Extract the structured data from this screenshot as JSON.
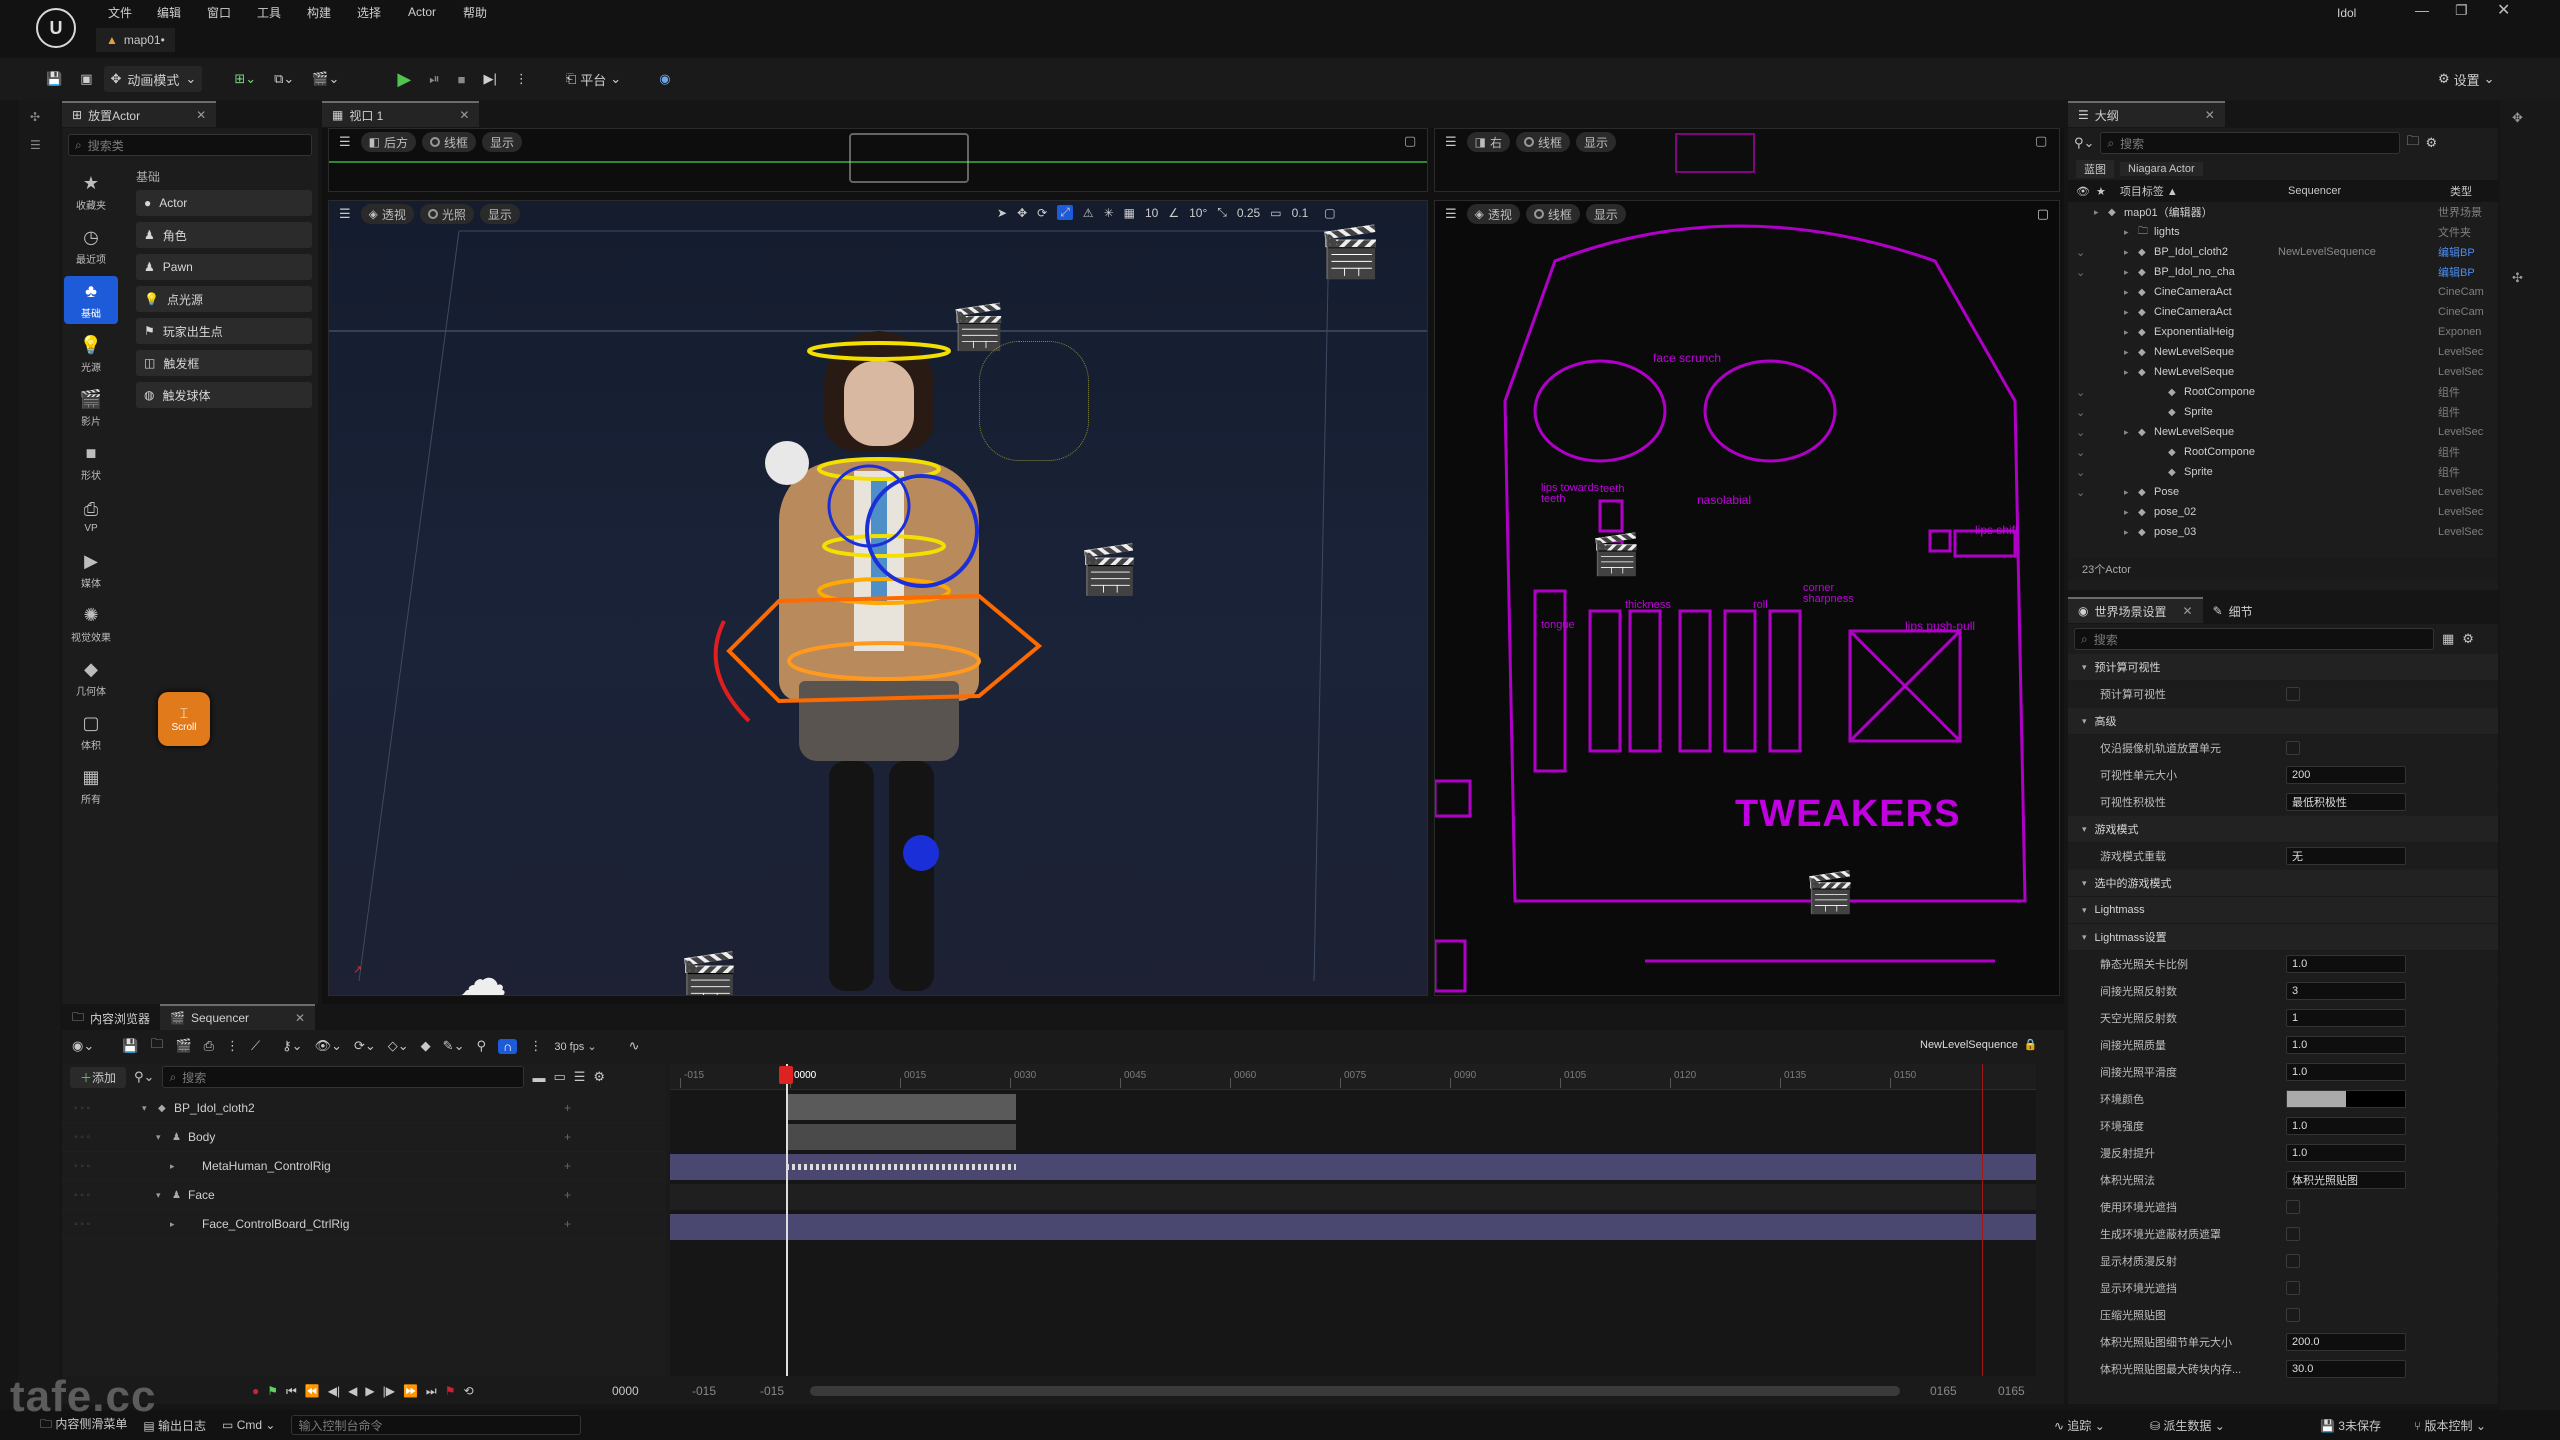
{
  "menu": {
    "items": [
      "文件",
      "编辑",
      "窗口",
      "工具",
      "构建",
      "选择",
      "Actor",
      "帮助"
    ],
    "project": "Idol"
  },
  "map_tab": "map01•",
  "toolbar": {
    "mode": "动画模式",
    "platform": "平台",
    "settings": "设置"
  },
  "place_actor": {
    "tab": "放置Actor",
    "search_placeholder": "搜索类",
    "category": "基础",
    "nav": [
      "收藏夹",
      "最近项",
      "基础",
      "光源",
      "影片",
      "形状",
      "VP",
      "媒体",
      "视觉效果",
      "几何体",
      "体积",
      "所有"
    ],
    "items": [
      "Actor",
      "角色",
      "Pawn",
      "点光源",
      "玩家出生点",
      "触发框",
      "触发球体"
    ]
  },
  "scroll_badge": "Scroll",
  "viewport": {
    "tab": "视口 1",
    "top_left": {
      "view": "后方",
      "mode": "线框",
      "show": "显示"
    },
    "main": {
      "view": "透视",
      "mode": "光照",
      "show": "显示",
      "grid": "10",
      "angle": "10°",
      "scale": "0.25",
      "cam": "0.1"
    },
    "top_right": {
      "view": "右",
      "mode": "线框",
      "show": "显示"
    },
    "right": {
      "view": "透视",
      "mode": "线框",
      "show": "显示"
    },
    "rig_labels": [
      "face scrunch",
      "lips towards teeth",
      "teeth",
      "nasolabial",
      "lips shift",
      "tongue",
      "thickness",
      "roll",
      "corner sharpness",
      "lips push-pull"
    ],
    "tweakers": "TWEAKERS"
  },
  "outliner": {
    "tab": "大纲",
    "search_placeholder": "搜索",
    "filters": [
      "蓝图",
      "Niagara Actor"
    ],
    "columns": {
      "label": "项目标签 ▲",
      "seq": "Sequencer",
      "type": "类型"
    },
    "rows": [
      {
        "label": "map01（编辑器）",
        "seq": "",
        "type": "世界场景"
      },
      {
        "label": "lights",
        "seq": "",
        "type": "文件夹"
      },
      {
        "label": "BP_Idol_cloth2",
        "seq": "NewLevelSequence",
        "type": "编辑BP"
      },
      {
        "label": "BP_Idol_no_cha",
        "seq": "",
        "type": "编辑BP"
      },
      {
        "label": "CineCameraAct",
        "seq": "",
        "type": "CineCam"
      },
      {
        "label": "CineCameraAct",
        "seq": "",
        "type": "CineCam"
      },
      {
        "label": "ExponentialHeig",
        "seq": "",
        "type": "Exponen"
      },
      {
        "label": "NewLevelSeque",
        "seq": "",
        "type": "LevelSec"
      },
      {
        "label": "NewLevelSeque",
        "seq": "",
        "type": "LevelSec"
      },
      {
        "label": "RootCompone",
        "seq": "",
        "type": "组件"
      },
      {
        "label": "Sprite",
        "seq": "",
        "type": "组件"
      },
      {
        "label": "NewLevelSeque",
        "seq": "",
        "type": "LevelSec"
      },
      {
        "label": "RootCompone",
        "seq": "",
        "type": "组件"
      },
      {
        "label": "Sprite",
        "seq": "",
        "type": "组件"
      },
      {
        "label": "Pose",
        "seq": "",
        "type": "LevelSec"
      },
      {
        "label": "pose_02",
        "seq": "",
        "type": "LevelSec"
      },
      {
        "label": "pose_03",
        "seq": "",
        "type": "LevelSec"
      }
    ],
    "count": "23个Actor"
  },
  "details": {
    "tab": "世界场景设置",
    "tab2": "细节",
    "search_placeholder": "搜索",
    "rows": [
      {
        "kind": "sec",
        "label": "预计算可视性"
      },
      {
        "kind": "chk",
        "label": "预计算可视性"
      },
      {
        "kind": "sec",
        "label": "高级"
      },
      {
        "kind": "chk",
        "label": "仅沿摄像机轨道放置单元"
      },
      {
        "kind": "val",
        "label": "可视性单元大小",
        "value": "200"
      },
      {
        "kind": "val",
        "label": "可视性积极性",
        "value": "最低积极性"
      },
      {
        "kind": "sec",
        "label": "游戏模式"
      },
      {
        "kind": "val",
        "label": "游戏模式重载",
        "value": "无"
      },
      {
        "kind": "sec",
        "label": "选中的游戏模式"
      },
      {
        "kind": "sec",
        "label": "Lightmass"
      },
      {
        "kind": "sec",
        "label": "Lightmass设置"
      },
      {
        "kind": "val",
        "label": "静态光照关卡比例",
        "value": "1.0"
      },
      {
        "kind": "val",
        "label": "间接光照反射数",
        "value": "3"
      },
      {
        "kind": "val",
        "label": "天空光照反射数",
        "value": "1"
      },
      {
        "kind": "val",
        "label": "间接光照质量",
        "value": "1.0"
      },
      {
        "kind": "val",
        "label": "间接光照平滑度",
        "value": "1.0"
      },
      {
        "kind": "col",
        "label": "环境颜色"
      },
      {
        "kind": "val",
        "label": "环境强度",
        "value": "1.0"
      },
      {
        "kind": "val",
        "label": "漫反射提升",
        "value": "1.0"
      },
      {
        "kind": "val",
        "label": "体积光照法",
        "value": "体积光照贴图"
      },
      {
        "kind": "chk",
        "label": "使用环境光遮挡"
      },
      {
        "kind": "chk",
        "label": "生成环境光遮蔽材质遮罩"
      },
      {
        "kind": "chk",
        "label": "显示材质漫反射"
      },
      {
        "kind": "chk",
        "label": "显示环境光遮挡"
      },
      {
        "kind": "chk",
        "label": "压缩光照贴图"
      },
      {
        "kind": "val",
        "label": "体积光照贴图细节单元大小",
        "value": "200.0"
      },
      {
        "kind": "val",
        "label": "体积光照贴图最大砖块内存...",
        "value": "30.0"
      }
    ]
  },
  "bottom_tabs": {
    "content": "内容浏览器",
    "sequencer": "Sequencer"
  },
  "sequencer": {
    "add": "添加",
    "search_placeholder": "搜索",
    "fps": "30 fps",
    "sequence_name": "NewLevelSequence",
    "current_frame": "0000",
    "tracks": [
      {
        "label": "BP_Idol_cloth2",
        "indent": 0
      },
      {
        "label": "Body",
        "indent": 1
      },
      {
        "label": "MetaHuman_ControlRig",
        "indent": 2
      },
      {
        "label": "Face",
        "indent": 1
      },
      {
        "label": "Face_ControlBoard_CtrlRig",
        "indent": 2
      }
    ],
    "ticks": [
      "-015",
      "0000",
      "0015",
      "0030",
      "0045",
      "0060",
      "0075",
      "0090",
      "0105",
      "0120",
      "0135",
      "0150"
    ],
    "range_start": "-015",
    "range_start2": "-015",
    "range_end": "0165",
    "range_end2": "0165",
    "frame_display": "0000"
  },
  "status": {
    "content_drawer": "内容侧滑菜单",
    "output_log": "输出日志",
    "cmd": "Cmd",
    "console_placeholder": "输入控制台命令",
    "trace": "追踪",
    "derived": "派生数据",
    "save": "3未保存",
    "source": "版本控制"
  },
  "watermark": "tafe.cc"
}
